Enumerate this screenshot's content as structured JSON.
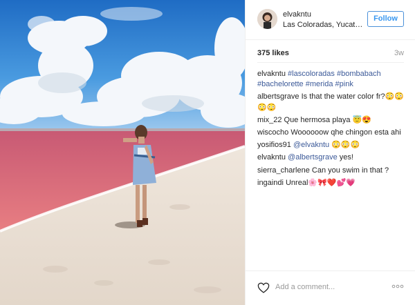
{
  "post": {
    "username": "elvakntu",
    "location": "Las Coloradas, Yucat…",
    "follow_label": "Follow",
    "likes": "375 likes",
    "time_ago": "3w"
  },
  "comments": [
    {
      "user": "elvakntu",
      "parts": [
        {
          "t": "tag",
          "v": "#lascoloradas"
        },
        {
          "t": "text",
          "v": " "
        },
        {
          "t": "tag",
          "v": "#bombabach"
        },
        {
          "t": "text",
          "v": " "
        },
        {
          "t": "tag",
          "v": "#bachelorette"
        },
        {
          "t": "text",
          "v": " "
        },
        {
          "t": "tag",
          "v": "#merida"
        },
        {
          "t": "text",
          "v": " "
        },
        {
          "t": "tag",
          "v": "#pink"
        }
      ]
    },
    {
      "user": "albertsgrave",
      "parts": [
        {
          "t": "text",
          "v": "Is that the water color fr?😳😳😳😳"
        }
      ]
    },
    {
      "user": "mix_22",
      "parts": [
        {
          "t": "text",
          "v": "Que hermosa playa 😇😍"
        }
      ]
    },
    {
      "user": "wiscocho",
      "parts": [
        {
          "t": "text",
          "v": "Woooooow qhe chingon esta ahi"
        }
      ]
    },
    {
      "user": "yosifios91",
      "parts": [
        {
          "t": "tag",
          "v": "@elvakntu"
        },
        {
          "t": "text",
          "v": " 😳😳😳"
        }
      ]
    },
    {
      "user": "elvakntu",
      "parts": [
        {
          "t": "tag",
          "v": "@albertsgrave"
        },
        {
          "t": "text",
          "v": " yes!"
        }
      ]
    },
    {
      "user": "sierra_charlene",
      "parts": [
        {
          "t": "text",
          "v": "Can you swim in that ?"
        }
      ]
    },
    {
      "user": "ingaindi",
      "parts": [
        {
          "t": "text",
          "v": "Unreal🌸🎀❤️💕💗"
        }
      ]
    }
  ],
  "footer": {
    "add_comment_placeholder": "Add a comment..."
  },
  "icons": {
    "like": "heart-icon",
    "more": "more-options-icon"
  },
  "colors": {
    "accent": "#3897f0",
    "hashtag": "#3b5998",
    "water": "#d9627c",
    "sky": "#3d8bd8"
  }
}
